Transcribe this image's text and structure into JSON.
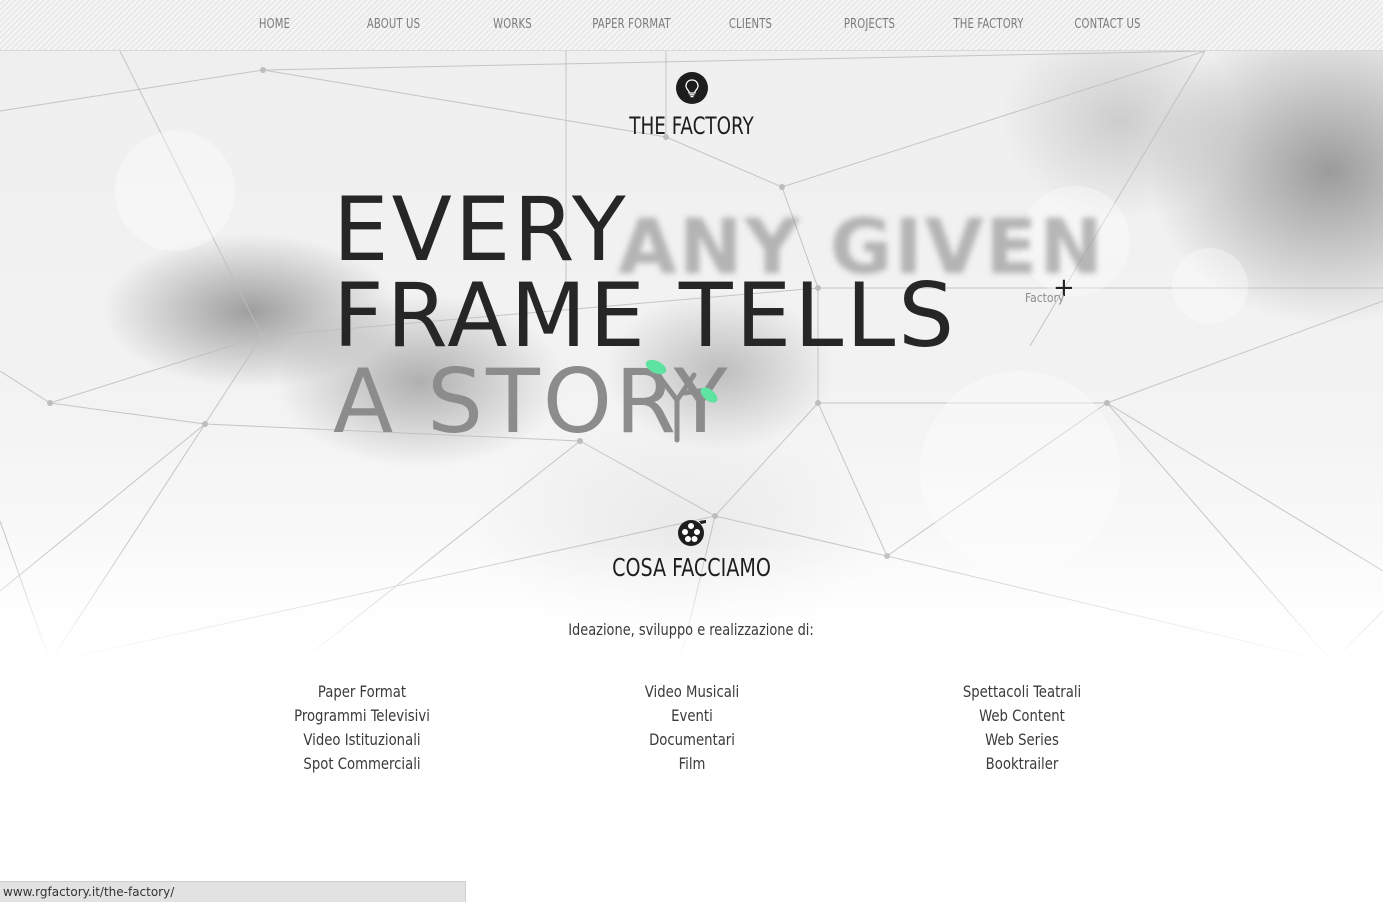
{
  "nav": {
    "items": [
      {
        "label": "HOME"
      },
      {
        "label": "ABOUT US"
      },
      {
        "label": "WORKS"
      },
      {
        "label": "PAPER FORMAT"
      },
      {
        "label": "CLIENTS"
      },
      {
        "label": "PROJECTS"
      },
      {
        "label": "THE FACTORY"
      },
      {
        "label": "CONTACT US"
      }
    ]
  },
  "hero": {
    "section_title": "THE FACTORY",
    "ghost_text": "ANY GIVEN",
    "headline_line1": "EVERY",
    "headline_line2": "FRAME TELLS",
    "headline_line3": "A STORY",
    "marker_label": "Factory"
  },
  "services": {
    "title": "COSA FACCIAMO",
    "intro": "Ideazione, sviluppo e realizzazione di:",
    "col1": [
      "Paper Format",
      "Programmi Televisivi",
      "Video Istituzionali",
      "Spot Commerciali"
    ],
    "col2": [
      "Video Musicali",
      "Eventi",
      "Documentari",
      "Film"
    ],
    "col3": [
      "Spettacoli Teatrali",
      "Web Content",
      "Web Series",
      "Booktrailer"
    ]
  },
  "status_bar": {
    "url": "www.rgfactory.it/the-factory/"
  },
  "colors": {
    "accent_leaf": "#5fe3a1",
    "dark": "#1d1d1d",
    "text_muted": "#8c8c8c"
  },
  "icons": {
    "logo": "lightbulb-icon",
    "services": "film-reel-icon",
    "marker": "plus-icon"
  }
}
